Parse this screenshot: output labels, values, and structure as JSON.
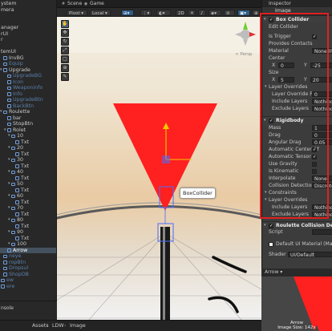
{
  "hierarchy": {
    "items": [
      {
        "label": "ystem",
        "color": "#c8c8c8"
      },
      {
        "label": "mera",
        "color": "#c8c8c8"
      },
      {
        "label": "",
        "color": "#c8c8c8"
      },
      {
        "label": "",
        "color": "#c8c8c8"
      },
      {
        "label": "anager",
        "color": "#c8c8c8"
      },
      {
        "label": "rUI",
        "color": "#c8c8c8"
      },
      {
        "label": "r",
        "color": "#c8c8c8"
      },
      {
        "label": "",
        "color": "#c8c8c8"
      },
      {
        "label": "temUI",
        "color": "#c8c8c8"
      },
      {
        "label": "InvBG",
        "color": "#c8c8c8"
      },
      {
        "label": "Equip",
        "color": "#5a7faa"
      },
      {
        "label": "Upgrade",
        "color": "#c8c8c8"
      },
      {
        "label": "UpgradeBG",
        "color": "#5a7faa"
      },
      {
        "label": "Icon",
        "color": "#5a7faa"
      },
      {
        "label": "Weaponinfo",
        "color": "#5a7faa"
      },
      {
        "label": "Info",
        "color": "#5a7faa"
      },
      {
        "label": "UpgradeBtn",
        "color": "#5a7faa"
      },
      {
        "label": "BackBtn",
        "color": "#5a7faa"
      },
      {
        "label": "Roulette",
        "color": "#c8c8c8"
      },
      {
        "label": "bar",
        "color": "#c8c8c8"
      },
      {
        "label": "StopBtn",
        "color": "#c8c8c8"
      },
      {
        "label": "Rolet",
        "color": "#c8c8c8"
      },
      {
        "label": "10",
        "color": "#c8c8c8"
      },
      {
        "label": "Txt",
        "color": "#c8c8c8"
      },
      {
        "label": "20",
        "color": "#c8c8c8"
      },
      {
        "label": "Txt",
        "color": "#c8c8c8"
      },
      {
        "label": "30",
        "color": "#c8c8c8"
      },
      {
        "label": "Txt",
        "color": "#c8c8c8"
      },
      {
        "label": "40",
        "color": "#c8c8c8"
      },
      {
        "label": "Txt",
        "color": "#c8c8c8"
      },
      {
        "label": "50",
        "color": "#c8c8c8"
      },
      {
        "label": "Txt",
        "color": "#c8c8c8"
      },
      {
        "label": "60",
        "color": "#c8c8c8"
      },
      {
        "label": "Txt",
        "color": "#c8c8c8"
      },
      {
        "label": "70",
        "color": "#c8c8c8"
      },
      {
        "label": "Txt",
        "color": "#c8c8c8"
      },
      {
        "label": "80",
        "color": "#c8c8c8"
      },
      {
        "label": "Txt",
        "color": "#c8c8c8"
      },
      {
        "label": "90",
        "color": "#c8c8c8"
      },
      {
        "label": "Txt",
        "color": "#c8c8c8"
      },
      {
        "label": "100",
        "color": "#c8c8c8"
      },
      {
        "label": "Arrow",
        "color": "#ffffff"
      },
      {
        "label": "neye",
        "color": "#5a7faa"
      },
      {
        "label": "ropBtn",
        "color": "#5a7faa"
      },
      {
        "label": "Dropsul",
        "color": "#5a7faa"
      },
      {
        "label": "ShopDB",
        "color": "#5a7faa"
      },
      {
        "label": "ew",
        "color": "#5a7faa"
      },
      {
        "label": "ere",
        "color": "#5a7faa"
      }
    ],
    "bottom_tab": "nsole"
  },
  "scene": {
    "tabs": [
      "Scene",
      "Game"
    ],
    "toolbar": {
      "pivot": "Pivot",
      "space": "Local"
    },
    "gizmo_label": "< Persp",
    "collider_label": "BoxCollider"
  },
  "project_bar": {
    "breadcrumb": [
      "Assets",
      "LDW",
      "Image"
    ]
  },
  "inspector": {
    "tab": "Inspector",
    "object_name": "Image",
    "box_collider": {
      "title": "Box Collider",
      "edit_collider": "Edit Collider",
      "is_trigger": "Is Trigger",
      "provides_contacts": "Provides Contacts",
      "material_label": "Material",
      "material_value": "None (Phy",
      "center_label": "Center",
      "center_x": "0",
      "center_y": "-25",
      "size_label": "Size",
      "size_x": "5",
      "size_y": "20",
      "layer_overrides": "Layer Overrides",
      "layer_override_priority": "Layer Override Pri",
      "layer_override_priority_value": "0",
      "include_layers": "Include Layers",
      "include_layers_value": "Nothing",
      "exclude_layers": "Exclude Layers",
      "exclude_layers_value": "Nothing"
    },
    "rigidbody": {
      "title": "Rigidbody",
      "mass_label": "Mass",
      "mass_value": "1",
      "drag_label": "Drag",
      "drag_value": "0",
      "angular_drag_label": "Angular Drag",
      "angular_drag_value": "0.05",
      "auto_center": "Automatic Center Of",
      "auto_tensor": "Automatic Tensor",
      "use_gravity": "Use Gravity",
      "is_kinematic": "Is Kinematic",
      "interpolate_label": "Interpolate",
      "interpolate_value": "None",
      "collision_label": "Collision Detection",
      "collision_value": "Discrete",
      "constraints": "Constraints",
      "layer_overrides": "Layer Overrides",
      "include_layers": "Include Layers",
      "include_layers_value": "Nothing",
      "exclude_layers": "Exclude Layers",
      "exclude_layers_value": "Nothing"
    },
    "script_component": "Roulette Collision Detec",
    "script_label": "Script",
    "material_default": "Default UI Material (Ma",
    "shader_label": "Shader",
    "shader_value": "UI/Default",
    "preview_title": "Arrow",
    "preview_caption_1": "Arrow",
    "preview_caption_2": "Image Size: 142x"
  },
  "colors": {
    "accent_red": "#ff2020",
    "selection": "#44515e",
    "highlight_frame": "#e02020"
  }
}
